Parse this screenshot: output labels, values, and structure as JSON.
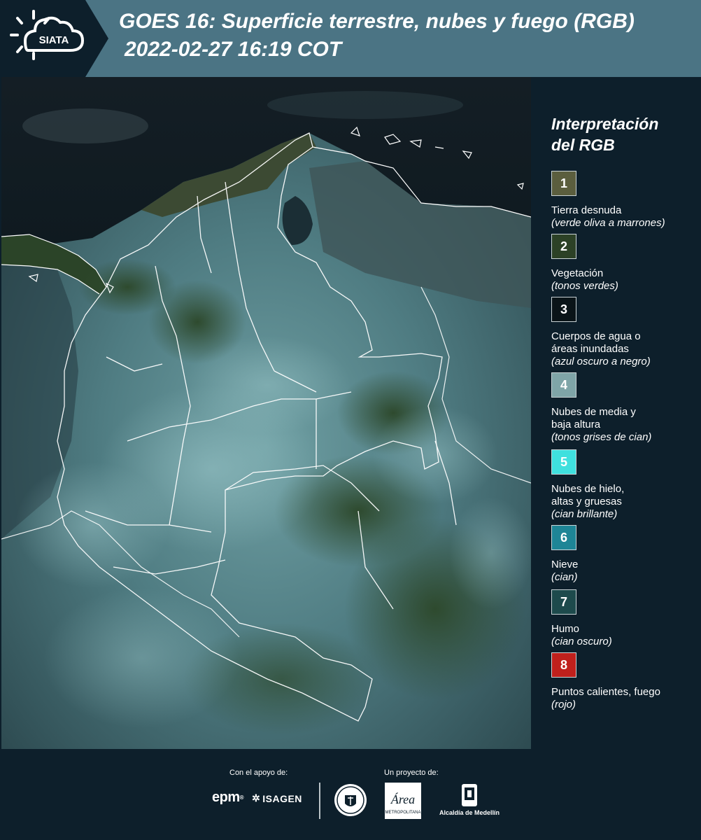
{
  "header": {
    "logo_text": "SIATA",
    "title_line1": "GOES 16: Superficie terrestre, nubes y fuego (RGB)",
    "title_line2": "2022-02-27 16:19 COT"
  },
  "map": {
    "icon": "satellite-map-colombia"
  },
  "legend": {
    "title_line1": "Interpretación",
    "title_line2": "del RGB",
    "items": [
      {
        "number": "1",
        "label_line1": "Tierra desnuda",
        "label_line2": "",
        "sub": "(verde oliva a marrones)",
        "color": "#5b5e3e"
      },
      {
        "number": "2",
        "label_line1": "Vegetación",
        "label_line2": "",
        "sub": "(tonos verdes)",
        "color": "#2c4126"
      },
      {
        "number": "3",
        "label_line1": "Cuerpos de agua o",
        "label_line2": "áreas inundadas",
        "sub": "(azul oscuro a negro)",
        "color": "#0a1418"
      },
      {
        "number": "4",
        "label_line1": "Nubes de media y",
        "label_line2": "baja altura",
        "sub": "(tonos grises de cian)",
        "color": "#7fa5a8"
      },
      {
        "number": "5",
        "label_line1": "Nubes de hielo,",
        "label_line2": "altas y gruesas",
        "sub": "(cian brillante)",
        "color": "#3fe0de"
      },
      {
        "number": "6",
        "label_line1": "Nieve",
        "label_line2": "",
        "sub": "(cian)",
        "color": "#1e8596"
      },
      {
        "number": "7",
        "label_line1": "Humo",
        "label_line2": "",
        "sub": "(cian oscuro)",
        "color": "#1d4a4c"
      },
      {
        "number": "8",
        "label_line1": "Puntos calientes, fuego",
        "label_line2": "",
        "sub": "(rojo)",
        "color": "#c0201c"
      }
    ]
  },
  "footer": {
    "support_caption": "Con el apoyo de:",
    "project_caption": "Un proyecto de:",
    "epm": "epm",
    "isagen": "ISAGEN",
    "area_text": "Área",
    "area_sub": "METROPOLITANA",
    "alcaldia": "Alcaldía de Medellín"
  }
}
